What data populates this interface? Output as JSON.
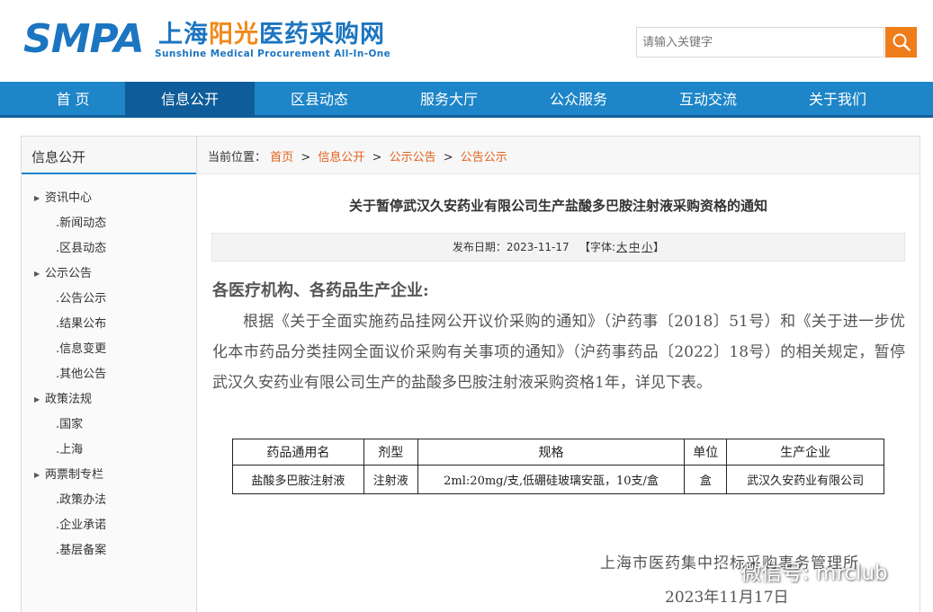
{
  "header": {
    "logo_main": "SMPA",
    "logo_cn_prefix": "上海",
    "logo_cn_highlight": "阳光",
    "logo_cn_suffix": "医药采购网",
    "logo_en": "Sunshine Medical Procurement All-In-One",
    "search_placeholder": "请输入关键字"
  },
  "nav": {
    "items": [
      {
        "label": "首 页"
      },
      {
        "label": "信息公开"
      },
      {
        "label": "区县动态"
      },
      {
        "label": "服务大厅"
      },
      {
        "label": "公众服务"
      },
      {
        "label": "互动交流"
      },
      {
        "label": "关于我们"
      }
    ],
    "active_index": 1
  },
  "sidebar": {
    "title": "信息公开",
    "groups": [
      {
        "label": "资讯中心",
        "items": [
          ".新闻动态",
          ".区县动态"
        ]
      },
      {
        "label": "公示公告",
        "items": [
          ".公告公示",
          ".结果公布",
          ".信息变更",
          ".其他公告"
        ]
      },
      {
        "label": "政策法规",
        "items": [
          ".国家",
          ".上海"
        ]
      },
      {
        "label": "两票制专栏",
        "items": [
          ".政策办法",
          ".企业承诺",
          ".基层备案"
        ]
      }
    ]
  },
  "breadcrumb": {
    "label": "当前位置：",
    "items": [
      "首页",
      "信息公开",
      "公示公告",
      "公告公示"
    ],
    "separator": ">"
  },
  "article": {
    "title": "关于暂停武汉久安药业有限公司生产盐酸多巴胺注射液采购资格的通知",
    "date_label": "发布日期：",
    "date": "2023-11-17",
    "font_label_prefix": "【字体:",
    "font_large": "大",
    "font_medium": "中",
    "font_small": "小",
    "font_label_suffix": "】",
    "salutation": "各医疗机构、各药品生产企业:",
    "body": "根据《关于全面实施药品挂网公开议价采购的通知》（沪药事〔2018〕51号）和《关于进一步优化本市药品分类挂网全面议价采购有关事项的通知》（沪药事药品〔2022〕18号）的相关规定，暂停武汉久安药业有限公司生产的盐酸多巴胺注射液采购资格1年，详见下表。",
    "table": {
      "headers": [
        "药品通用名",
        "剂型",
        "规格",
        "单位",
        "生产企业"
      ],
      "rows": [
        [
          "盐酸多巴胺注射液",
          "注射液",
          "2ml:20mg/支,低硼硅玻璃安瓿，10支/盒",
          "盒",
          "武汉久安药业有限公司"
        ]
      ]
    },
    "signature": "上海市医药集中招标采购事务管理所",
    "sign_date": "2023年11月17日"
  },
  "watermark": "微信号: mrclub",
  "colors": {
    "brand_blue": "#1c75c0",
    "nav_blue": "#1d85c8",
    "nav_active": "#0e5c99",
    "accent_orange": "#ef7d1a",
    "link_orange": "#e4611b"
  },
  "icons": {
    "search": "search-icon",
    "sidebar_bullet": "triangle-right-icon",
    "watermark": "wechat-icon"
  }
}
